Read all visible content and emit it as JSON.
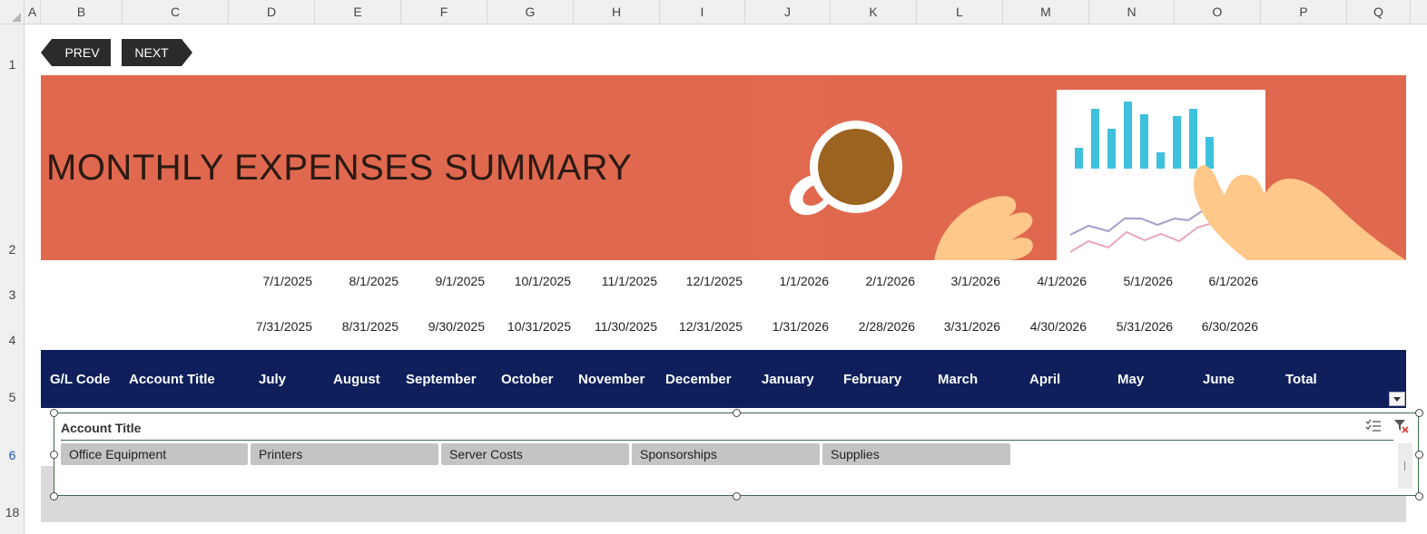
{
  "columns": [
    "A",
    "B",
    "C",
    "D",
    "E",
    "F",
    "G",
    "H",
    "I",
    "J",
    "K",
    "L",
    "M",
    "N",
    "O",
    "P",
    "Q"
  ],
  "rows": [
    "1",
    "2",
    "3",
    "4",
    "5",
    "6",
    "18"
  ],
  "nav": {
    "prev_label": "PREV",
    "next_label": "NEXT"
  },
  "banner": {
    "title": "MONTHLY EXPENSES SUMMARY",
    "color": "#e0684e"
  },
  "start_dates": [
    "7/1/2025",
    "8/1/2025",
    "9/1/2025",
    "10/1/2025",
    "11/1/2025",
    "12/1/2025",
    "1/1/2026",
    "2/1/2026",
    "3/1/2026",
    "4/1/2026",
    "5/1/2026",
    "6/1/2026"
  ],
  "end_dates": [
    "7/31/2025",
    "8/31/2025",
    "9/30/2025",
    "10/31/2025",
    "11/30/2025",
    "12/31/2025",
    "1/31/2026",
    "2/28/2026",
    "3/31/2026",
    "4/30/2026",
    "5/31/2026",
    "6/30/2026"
  ],
  "table": {
    "header_color": "#0e1f5c",
    "headers": [
      "G/L Code",
      "Account Title",
      "July",
      "August",
      "September",
      "October",
      "November",
      "December",
      "January",
      "February",
      "March",
      "April",
      "May",
      "June",
      "Total"
    ]
  },
  "slicer": {
    "title": "Account Title",
    "items": [
      "Office Equipment",
      "Printers",
      "Server Costs",
      "Sponsorships",
      "Supplies"
    ],
    "icons": [
      "multi-select-icon",
      "clear-filter-icon"
    ]
  }
}
